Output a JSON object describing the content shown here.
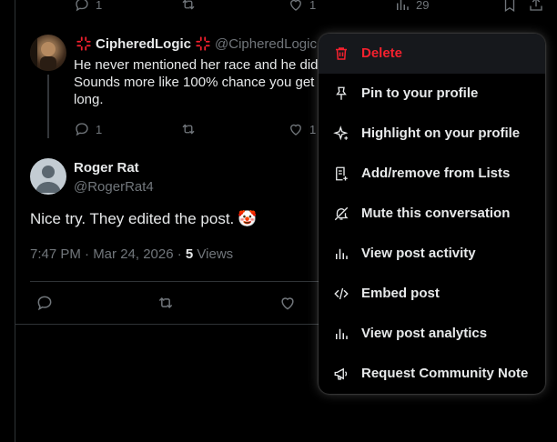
{
  "top_actions": {
    "reply_count": "1",
    "like_count": "1",
    "views_count": "29"
  },
  "reply1": {
    "name": "CipheredLogic",
    "handle": "@CipheredLogic",
    "lines": [
      "He never mentioned her race and he did",
      "Sounds more like 100% chance you get",
      "long."
    ],
    "reply_count": "1",
    "like_count": "1"
  },
  "main_post": {
    "name": "Roger Rat",
    "handle": "@RogerRat4",
    "text": "Nice try. They edited the post.",
    "emoji": "🤡",
    "timestamp": "7:47 PM · Mar 24, 2026 · ",
    "views_number": "5",
    "views_label": " Views"
  },
  "menu": {
    "items": [
      {
        "label": "Delete",
        "icon": "trash-icon",
        "danger": true
      },
      {
        "label": "Pin to your profile",
        "icon": "pin-icon"
      },
      {
        "label": "Highlight on your profile",
        "icon": "sparkle-icon"
      },
      {
        "label": "Add/remove from Lists",
        "icon": "list-icon"
      },
      {
        "label": "Mute this conversation",
        "icon": "mute-icon"
      },
      {
        "label": "View post activity",
        "icon": "chart-icon"
      },
      {
        "label": "Embed post",
        "icon": "code-icon"
      },
      {
        "label": "View post analytics",
        "icon": "analytics-icon"
      },
      {
        "label": "Request Community Note",
        "icon": "megaphone-icon"
      }
    ]
  },
  "colors": {
    "danger": "#f4212e",
    "text": "#e7e9ea",
    "muted": "#71767b",
    "border": "#2f3336",
    "accent_red": "#f91880"
  }
}
